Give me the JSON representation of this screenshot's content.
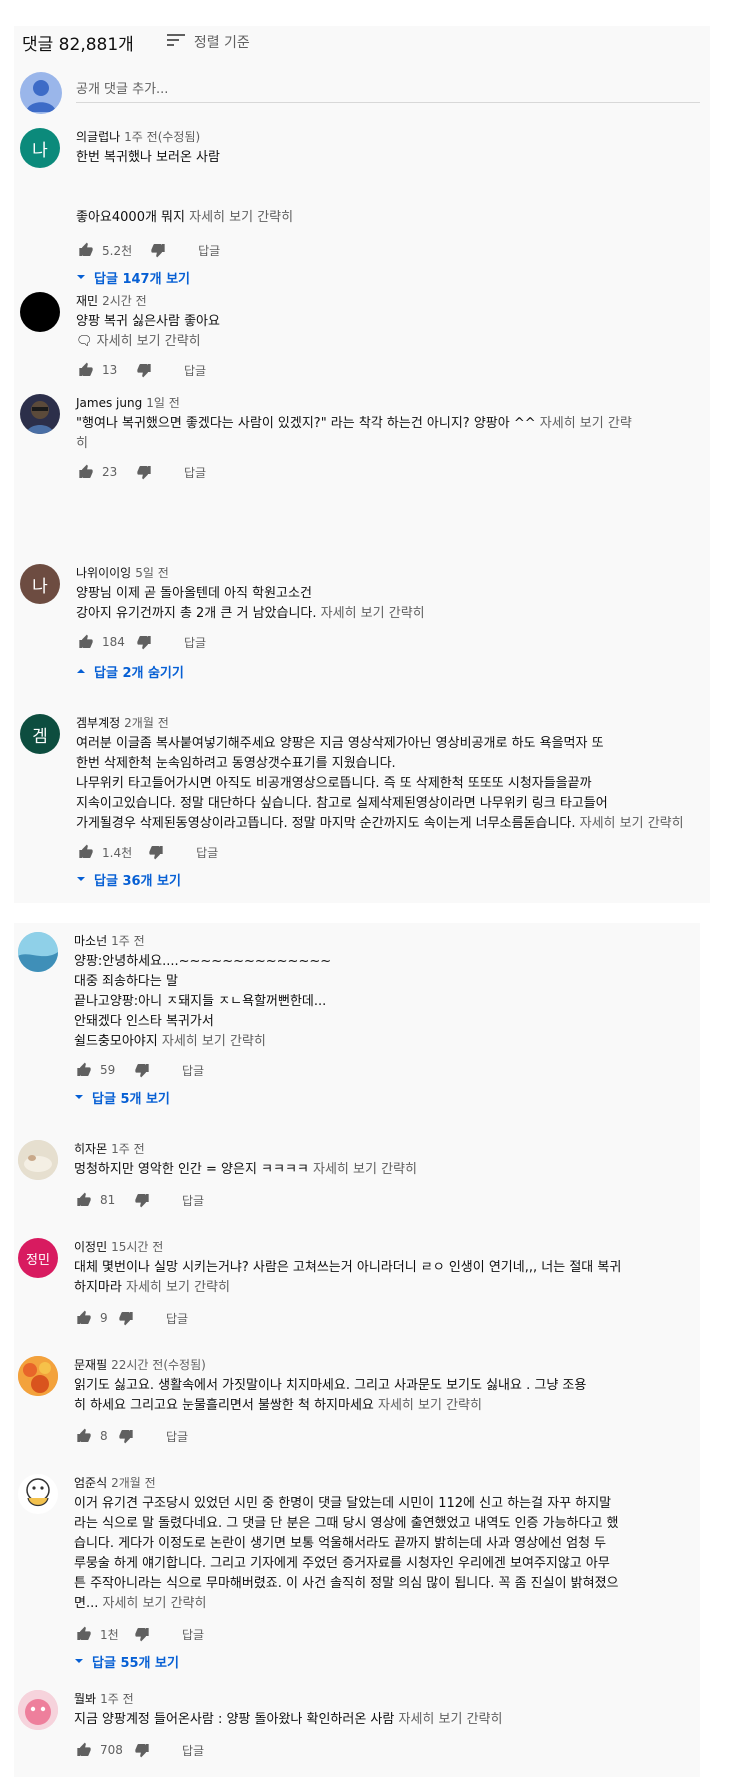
{
  "header": {
    "count": "댓글 82,881개",
    "sort_label": "정렬 기준"
  },
  "add_comment": {
    "placeholder": "공개 댓글 추가..."
  },
  "ui": {
    "read_more": "자세히 보기",
    "show_less": "간략히",
    "reply": "답글"
  },
  "colors": {
    "link_blue": "#065fd4",
    "secondary_text": "#606060",
    "panel_bg": "#f9f9f9"
  },
  "comments": [
    {
      "author": "의글럽나",
      "time": "1주 전(수정됨)",
      "avatar_letter": "나",
      "avatar_color": "#0b8a7b",
      "lines": [
        "한번 복귀했나 보러온 사람",
        "",
        "",
        "좋아요4000개 뭐지"
      ],
      "likes": "5.2천",
      "replies_label": "답글 147개 보기"
    },
    {
      "author": "재민",
      "time": "2시간 전",
      "avatar_letter": "",
      "avatar_color": "#000000",
      "lines": [
        "양팡 복귀 싫은사람 좋아요",
        "🗨"
      ],
      "likes": "13",
      "replies_label": ""
    },
    {
      "author": "James jung",
      "time": "1일 전",
      "avatar_letter": "",
      "avatar_color": "#2c2f4a",
      "lines": [
        "\"행여나 복귀했으면 좋겠다는 사람이 있겠지?\" 라는 착각 하는건 아니지? 양팡아 ^^"
      ],
      "likes": "23",
      "replies_label": ""
    },
    {
      "author": "나위이이잉",
      "time": "5일 전",
      "avatar_letter": "나",
      "avatar_color": "#6d4c41",
      "lines": [
        "양팡님 이제 곧 돌아올텐데 아직 학원고소건",
        "강아지 유기건까지 총 2개 큰 거 남았습니다."
      ],
      "likes": "184",
      "replies_label": "답글 2개 숨기기"
    },
    {
      "author": "겜부계정",
      "time": "2개월 전",
      "avatar_letter": "겜",
      "avatar_color": "#0d4d3f",
      "lines": [
        "여러분 이글좀 복사붙여넣기해주세요  양팡은 지금 영상삭제가아닌 영상비공개로 하도 욕을먹자 또",
        "한번 삭제한척 눈속임하려고 동영상갯수표기를 지웠습니다.",
        " 나무위키 타고들어가시면  아직도 비공개영상으로뜹니다.   즉  또 삭제한척  또또또 시청자들을끝까",
        "지속이고있습니다. 정말 대단하다 싶습니다.  참고로 실제삭제된영상이라면 나무위키 링크 타고들어",
        "가게될경우 삭제된동영상이라고뜹니다. 정말 마지막 순간까지도 속이는게 너무소름돋습니다."
      ],
      "likes": "1.4천",
      "replies_label": "답글 36개 보기"
    },
    {
      "author": "마소넌",
      "time": "1주 전",
      "avatar_letter": "",
      "avatar_color": "#6fb7d9",
      "lines": [
        "양팡:안녕하세요....~~~~~~~~~~~~~~",
        "대중 죄송하다는 말",
        "끝나고양팡:아니 ㅈ돼지들 ㅈㄴ욕할꺼뻔한데...",
        "안돼겠다 인스타 복귀가서",
        "쉴드충모아야지"
      ],
      "likes": "59",
      "replies_label": "답글 5개 보기"
    },
    {
      "author": "히자몬",
      "time": "1주 전",
      "avatar_letter": "",
      "avatar_color": "#d8d2c4",
      "lines": [
        "멍청하지만 영악한 인간 = 양은지 ㅋㅋㅋㅋ"
      ],
      "likes": "81",
      "replies_label": ""
    },
    {
      "author": "이정민",
      "time": "15시간 전",
      "avatar_letter": "정민",
      "avatar_color": "#d81b60",
      "lines": [
        "대체 몇번이나 실망 시키는거냐? 사람은 고쳐쓰는거 아니라더니 ㄹㅇ 인생이 연기네,,, 너는 절대 복귀",
        "하지마라"
      ],
      "likes": "9",
      "replies_label": ""
    },
    {
      "author": "문재필",
      "time": "22시간 전(수정됨)",
      "avatar_letter": "",
      "avatar_color": "#e8842a",
      "lines": [
        "읽기도 싫고요.  생활속에서 가짓말이나 치지마세요.     그리고  사과문도 보기도 싫내요 .   그냥 조용",
        "히 하세요       그리고요 눈물흘리면서 불쌍한 척 하지마세요"
      ],
      "likes": "8",
      "replies_label": ""
    },
    {
      "author": "엄준식",
      "time": "2개월 전",
      "avatar_letter": "",
      "avatar_color": "#ffffff",
      "lines": [
        "이거 유기견 구조당시 있었던 시민 중 한명이 댓글 달았는데 시민이 112에 신고 하는걸 자꾸 하지말",
        "라는 식으로 말 돌렸다네요. 그 댓글 단 분은 그때 당시 영상에 출연했었고 내역도 인증 가능하다고 했",
        "습니다. 게다가 이정도로 논란이 생기면 보통 억울해서라도 끝까지 밝히는데 사과 영상에선 엄청 두",
        "루뭉술 하게 얘기합니다. 그리고 기자에게 주었던 증거자료를 시청자인 우리에겐 보여주지않고 아무",
        "튼 주작아니라는 식으로 무마해버렸죠. 이 사건 솔직히 정말 의심 많이 됩니다. 꼭 좀 진실이 밝혀졌으",
        "면..."
      ],
      "likes": "1천",
      "replies_label": "답글 55개 보기"
    },
    {
      "author": "뭘봐",
      "time": "1주 전",
      "avatar_letter": "",
      "avatar_color": "#f2b8c4",
      "lines": [
        "지금 양팡계정 들어온사람 : 양팡 돌아왔나 확인하러온 사람"
      ],
      "likes": "708",
      "replies_label": ""
    }
  ]
}
